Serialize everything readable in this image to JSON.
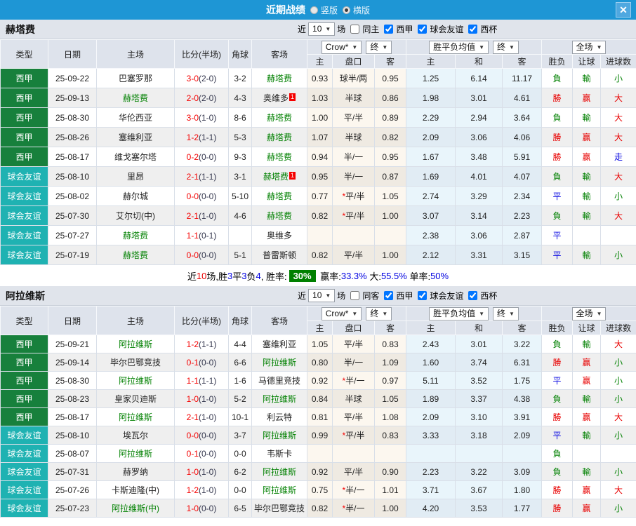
{
  "titlebar": {
    "title": "近期战绩",
    "view_options": [
      {
        "label": "竖版",
        "selected": false
      },
      {
        "label": "横版",
        "selected": true
      }
    ],
    "close_label": "✕"
  },
  "colors": {
    "accent_blue": "#1e96d5",
    "win_red": "#e80000",
    "loss_green": "#008000",
    "draw_blue": "#0000e0",
    "league_green": "#17803c",
    "friendly_teal": "#1fb2b2",
    "rate_badge_green": "#008000",
    "score_red": "#f50000"
  },
  "table_headers": {
    "cols": [
      "类型",
      "日期",
      "主场",
      "比分(半场)",
      "角球",
      "客场"
    ],
    "odds_group": {
      "bookmaker_dropdown": "Crow*",
      "final_dropdown": "终",
      "subcols": [
        "主",
        "盘口",
        "客"
      ]
    },
    "mean_group": {
      "dropdown": "胜平负均值",
      "final_dropdown": "终",
      "subcols": [
        "主",
        "和",
        "客"
      ]
    },
    "result_group": {
      "dropdown": "全场",
      "subcols": [
        "胜负",
        "让球",
        "进球数"
      ]
    }
  },
  "sections": [
    {
      "team": "赫塔费",
      "filters": {
        "near": "近",
        "count": "10",
        "unit": "场",
        "same": {
          "label": "同主",
          "checked": false
        },
        "comps": [
          {
            "label": "西甲",
            "checked": true
          },
          {
            "label": "球会友谊",
            "checked": true
          },
          {
            "label": "西杯",
            "checked": true
          }
        ]
      },
      "rows": [
        {
          "type": "西甲",
          "type_class": "league",
          "date": "25-09-22",
          "home": "巴塞罗那",
          "home_subject": false,
          "home_badge": "",
          "score_ft": "3-0",
          "score_ht": "(2-0)",
          "corners": "3-2",
          "away": "赫塔费",
          "away_subject": true,
          "away_badge": "",
          "odds_home": "0.93",
          "handicap": "球半/两",
          "handicap_star": false,
          "odds_away": "0.95",
          "mean_home": "1.25",
          "mean_draw": "6.14",
          "mean_away": "11.17",
          "result": "負",
          "result_class": "g",
          "let_ball": "輸",
          "let_class": "g",
          "goals": "小",
          "goals_class": "g"
        },
        {
          "type": "西甲",
          "type_class": "league",
          "date": "25-09-13",
          "home": "赫塔费",
          "home_subject": true,
          "home_badge": "",
          "score_ft": "2-0",
          "score_ht": "(2-0)",
          "corners": "4-3",
          "away": "奥维多",
          "away_subject": false,
          "away_badge": "1",
          "odds_home": "1.03",
          "handicap": "半球",
          "handicap_star": false,
          "odds_away": "0.86",
          "mean_home": "1.98",
          "mean_draw": "3.01",
          "mean_away": "4.61",
          "result": "勝",
          "result_class": "r",
          "let_ball": "赢",
          "let_class": "r",
          "goals": "大",
          "goals_class": "r"
        },
        {
          "type": "西甲",
          "type_class": "league",
          "date": "25-08-30",
          "home": "华伦西亚",
          "home_subject": false,
          "home_badge": "",
          "score_ft": "3-0",
          "score_ht": "(1-0)",
          "corners": "8-6",
          "away": "赫塔费",
          "away_subject": true,
          "away_badge": "",
          "odds_home": "1.00",
          "handicap": "平/半",
          "handicap_star": false,
          "odds_away": "0.89",
          "mean_home": "2.29",
          "mean_draw": "2.94",
          "mean_away": "3.64",
          "result": "負",
          "result_class": "g",
          "let_ball": "輸",
          "let_class": "g",
          "goals": "大",
          "goals_class": "r"
        },
        {
          "type": "西甲",
          "type_class": "league",
          "date": "25-08-26",
          "home": "塞维利亚",
          "home_subject": false,
          "home_badge": "",
          "score_ft": "1-2",
          "score_ht": "(1-1)",
          "corners": "5-3",
          "away": "赫塔费",
          "away_subject": true,
          "away_badge": "",
          "odds_home": "1.07",
          "handicap": "半球",
          "handicap_star": false,
          "odds_away": "0.82",
          "mean_home": "2.09",
          "mean_draw": "3.06",
          "mean_away": "4.06",
          "result": "勝",
          "result_class": "r",
          "let_ball": "赢",
          "let_class": "r",
          "goals": "大",
          "goals_class": "r"
        },
        {
          "type": "西甲",
          "type_class": "league",
          "date": "25-08-17",
          "home": "维戈塞尔塔",
          "home_subject": false,
          "home_badge": "",
          "score_ft": "0-2",
          "score_ht": "(0-0)",
          "corners": "9-3",
          "away": "赫塔费",
          "away_subject": true,
          "away_badge": "",
          "odds_home": "0.94",
          "handicap": "半/一",
          "handicap_star": false,
          "odds_away": "0.95",
          "mean_home": "1.67",
          "mean_draw": "3.48",
          "mean_away": "5.91",
          "result": "勝",
          "result_class": "r",
          "let_ball": "赢",
          "let_class": "r",
          "goals": "走",
          "goals_class": "b"
        },
        {
          "type": "球会友谊",
          "type_class": "friendly",
          "date": "25-08-10",
          "home": "里昂",
          "home_subject": false,
          "home_badge": "",
          "score_ft": "2-1",
          "score_ht": "(1-1)",
          "corners": "3-1",
          "away": "赫塔费",
          "away_subject": true,
          "away_badge": "1",
          "odds_home": "0.95",
          "handicap": "半/一",
          "handicap_star": false,
          "odds_away": "0.87",
          "mean_home": "1.69",
          "mean_draw": "4.01",
          "mean_away": "4.07",
          "result": "負",
          "result_class": "g",
          "let_ball": "輸",
          "let_class": "g",
          "goals": "大",
          "goals_class": "r"
        },
        {
          "type": "球会友谊",
          "type_class": "friendly",
          "date": "25-08-02",
          "home": "赫尔城",
          "home_subject": false,
          "home_badge": "",
          "score_ft": "0-0",
          "score_ht": "(0-0)",
          "corners": "5-10",
          "away": "赫塔费",
          "away_subject": true,
          "away_badge": "",
          "odds_home": "0.77",
          "handicap": "平/半",
          "handicap_star": true,
          "odds_away": "1.05",
          "mean_home": "2.74",
          "mean_draw": "3.29",
          "mean_away": "2.34",
          "result": "平",
          "result_class": "b",
          "let_ball": "輸",
          "let_class": "g",
          "goals": "小",
          "goals_class": "g"
        },
        {
          "type": "球会友谊",
          "type_class": "friendly",
          "date": "25-07-30",
          "home": "艾尔切(中)",
          "home_subject": false,
          "home_badge": "",
          "score_ft": "2-1",
          "score_ht": "(1-0)",
          "corners": "4-6",
          "away": "赫塔费",
          "away_subject": true,
          "away_badge": "",
          "odds_home": "0.82",
          "handicap": "平/半",
          "handicap_star": true,
          "odds_away": "1.00",
          "mean_home": "3.07",
          "mean_draw": "3.14",
          "mean_away": "2.23",
          "result": "負",
          "result_class": "g",
          "let_ball": "輸",
          "let_class": "g",
          "goals": "大",
          "goals_class": "r"
        },
        {
          "type": "球会友谊",
          "type_class": "friendly",
          "date": "25-07-27",
          "home": "赫塔费",
          "home_subject": true,
          "home_badge": "",
          "score_ft": "1-1",
          "score_ht": "(0-1)",
          "corners": "",
          "away": "奥维多",
          "away_subject": false,
          "away_badge": "",
          "odds_home": "",
          "handicap": "",
          "handicap_star": false,
          "odds_away": "",
          "mean_home": "2.38",
          "mean_draw": "3.06",
          "mean_away": "2.87",
          "result": "平",
          "result_class": "b",
          "let_ball": "",
          "let_class": "",
          "goals": "",
          "goals_class": ""
        },
        {
          "type": "球会友谊",
          "type_class": "friendly",
          "date": "25-07-19",
          "home": "赫塔费",
          "home_subject": true,
          "home_badge": "",
          "score_ft": "0-0",
          "score_ht": "(0-0)",
          "corners": "5-1",
          "away": "普雷斯顿",
          "away_subject": false,
          "away_badge": "",
          "odds_home": "0.82",
          "handicap": "平/半",
          "handicap_star": false,
          "odds_away": "1.00",
          "mean_home": "2.12",
          "mean_draw": "3.31",
          "mean_away": "3.15",
          "result": "平",
          "result_class": "b",
          "let_ball": "輸",
          "let_class": "g",
          "goals": "小",
          "goals_class": "g"
        }
      ],
      "summary_segments": [
        {
          "text": "近",
          "style": "plain"
        },
        {
          "text": "10",
          "style": "red"
        },
        {
          "text": "场,胜",
          "style": "plain"
        },
        {
          "text": "3",
          "style": "blue"
        },
        {
          "text": "平",
          "style": "plain"
        },
        {
          "text": "3",
          "style": "blue"
        },
        {
          "text": "负",
          "style": "plain"
        },
        {
          "text": "4",
          "style": "blue"
        },
        {
          "text": ", 胜率:",
          "style": "plain"
        },
        {
          "text": "30%",
          "style": "badge"
        },
        {
          "text": " 赢率:",
          "style": "plain"
        },
        {
          "text": "33.3%",
          "style": "blue"
        },
        {
          "text": " 大:",
          "style": "plain"
        },
        {
          "text": "55.5%",
          "style": "blue"
        },
        {
          "text": " 单率:",
          "style": "plain"
        },
        {
          "text": "50%",
          "style": "blue"
        }
      ]
    },
    {
      "team": "阿拉维斯",
      "filters": {
        "near": "近",
        "count": "10",
        "unit": "场",
        "same": {
          "label": "同客",
          "checked": false
        },
        "comps": [
          {
            "label": "西甲",
            "checked": true
          },
          {
            "label": "球会友谊",
            "checked": true
          },
          {
            "label": "西杯",
            "checked": true
          }
        ]
      },
      "rows": [
        {
          "type": "西甲",
          "type_class": "league",
          "date": "25-09-21",
          "home": "阿拉维斯",
          "home_subject": true,
          "home_badge": "",
          "score_ft": "1-2",
          "score_ht": "(1-1)",
          "corners": "4-4",
          "away": "塞维利亚",
          "away_subject": false,
          "away_badge": "",
          "odds_home": "1.05",
          "handicap": "平/半",
          "handicap_star": false,
          "odds_away": "0.83",
          "mean_home": "2.43",
          "mean_draw": "3.01",
          "mean_away": "3.22",
          "result": "負",
          "result_class": "g",
          "let_ball": "輸",
          "let_class": "g",
          "goals": "大",
          "goals_class": "r"
        },
        {
          "type": "西甲",
          "type_class": "league",
          "date": "25-09-14",
          "home": "毕尔巴鄂竞技",
          "home_subject": false,
          "home_badge": "",
          "score_ft": "0-1",
          "score_ht": "(0-0)",
          "corners": "6-6",
          "away": "阿拉维斯",
          "away_subject": true,
          "away_badge": "",
          "odds_home": "0.80",
          "handicap": "半/一",
          "handicap_star": false,
          "odds_away": "1.09",
          "mean_home": "1.60",
          "mean_draw": "3.74",
          "mean_away": "6.31",
          "result": "勝",
          "result_class": "r",
          "let_ball": "赢",
          "let_class": "r",
          "goals": "小",
          "goals_class": "g"
        },
        {
          "type": "西甲",
          "type_class": "league",
          "date": "25-08-30",
          "home": "阿拉维斯",
          "home_subject": true,
          "home_badge": "",
          "score_ft": "1-1",
          "score_ht": "(1-1)",
          "corners": "1-6",
          "away": "马德里竞技",
          "away_subject": false,
          "away_badge": "",
          "odds_home": "0.92",
          "handicap": "半/一",
          "handicap_star": true,
          "odds_away": "0.97",
          "mean_home": "5.11",
          "mean_draw": "3.52",
          "mean_away": "1.75",
          "result": "平",
          "result_class": "b",
          "let_ball": "赢",
          "let_class": "r",
          "goals": "小",
          "goals_class": "g"
        },
        {
          "type": "西甲",
          "type_class": "league",
          "date": "25-08-23",
          "home": "皇家贝迪斯",
          "home_subject": false,
          "home_badge": "",
          "score_ft": "1-0",
          "score_ht": "(1-0)",
          "corners": "5-2",
          "away": "阿拉维斯",
          "away_subject": true,
          "away_badge": "",
          "odds_home": "0.84",
          "handicap": "半球",
          "handicap_star": false,
          "odds_away": "1.05",
          "mean_home": "1.89",
          "mean_draw": "3.37",
          "mean_away": "4.38",
          "result": "負",
          "result_class": "g",
          "let_ball": "輸",
          "let_class": "g",
          "goals": "小",
          "goals_class": "g"
        },
        {
          "type": "西甲",
          "type_class": "league",
          "date": "25-08-17",
          "home": "阿拉维斯",
          "home_subject": true,
          "home_badge": "",
          "score_ft": "2-1",
          "score_ht": "(1-0)",
          "corners": "10-1",
          "away": "利云特",
          "away_subject": false,
          "away_badge": "",
          "odds_home": "0.81",
          "handicap": "平/半",
          "handicap_star": false,
          "odds_away": "1.08",
          "mean_home": "2.09",
          "mean_draw": "3.10",
          "mean_away": "3.91",
          "result": "勝",
          "result_class": "r",
          "let_ball": "赢",
          "let_class": "r",
          "goals": "大",
          "goals_class": "r"
        },
        {
          "type": "球会友谊",
          "type_class": "friendly",
          "date": "25-08-10",
          "home": "埃瓦尔",
          "home_subject": false,
          "home_badge": "",
          "score_ft": "0-0",
          "score_ht": "(0-0)",
          "corners": "3-7",
          "away": "阿拉维斯",
          "away_subject": true,
          "away_badge": "",
          "odds_home": "0.99",
          "handicap": "平/半",
          "handicap_star": true,
          "odds_away": "0.83",
          "mean_home": "3.33",
          "mean_draw": "3.18",
          "mean_away": "2.09",
          "result": "平",
          "result_class": "b",
          "let_ball": "輸",
          "let_class": "g",
          "goals": "小",
          "goals_class": "g"
        },
        {
          "type": "球会友谊",
          "type_class": "friendly",
          "date": "25-08-07",
          "home": "阿拉维斯",
          "home_subject": true,
          "home_badge": "",
          "score_ft": "0-1",
          "score_ht": "(0-0)",
          "corners": "0-0",
          "away": "韦斯卡",
          "away_subject": false,
          "away_badge": "",
          "odds_home": "",
          "handicap": "",
          "handicap_star": false,
          "odds_away": "",
          "mean_home": "",
          "mean_draw": "",
          "mean_away": "",
          "result": "負",
          "result_class": "g",
          "let_ball": "",
          "let_class": "",
          "goals": "",
          "goals_class": ""
        },
        {
          "type": "球会友谊",
          "type_class": "friendly",
          "date": "25-07-31",
          "home": "赫罗纳",
          "home_subject": false,
          "home_badge": "",
          "score_ft": "1-0",
          "score_ht": "(1-0)",
          "corners": "6-2",
          "away": "阿拉维斯",
          "away_subject": true,
          "away_badge": "",
          "odds_home": "0.92",
          "handicap": "平/半",
          "handicap_star": false,
          "odds_away": "0.90",
          "mean_home": "2.23",
          "mean_draw": "3.22",
          "mean_away": "3.09",
          "result": "負",
          "result_class": "g",
          "let_ball": "輸",
          "let_class": "g",
          "goals": "小",
          "goals_class": "g"
        },
        {
          "type": "球会友谊",
          "type_class": "friendly",
          "date": "25-07-26",
          "home": "卡斯迪隆(中)",
          "home_subject": false,
          "home_badge": "",
          "score_ft": "1-2",
          "score_ht": "(1-0)",
          "corners": "0-0",
          "away": "阿拉维斯",
          "away_subject": true,
          "away_badge": "",
          "odds_home": "0.75",
          "handicap": "半/一",
          "handicap_star": true,
          "odds_away": "1.01",
          "mean_home": "3.71",
          "mean_draw": "3.67",
          "mean_away": "1.80",
          "result": "勝",
          "result_class": "r",
          "let_ball": "赢",
          "let_class": "r",
          "goals": "大",
          "goals_class": "r"
        },
        {
          "type": "球会友谊",
          "type_class": "friendly",
          "date": "25-07-23",
          "home": "阿拉维斯(中)",
          "home_subject": true,
          "home_badge": "",
          "score_ft": "1-0",
          "score_ht": "(0-0)",
          "corners": "6-5",
          "away": "毕尔巴鄂竞技",
          "away_subject": false,
          "away_badge": "",
          "odds_home": "0.82",
          "handicap": "半/一",
          "handicap_star": true,
          "odds_away": "1.00",
          "mean_home": "4.20",
          "mean_draw": "3.53",
          "mean_away": "1.77",
          "result": "勝",
          "result_class": "r",
          "let_ball": "赢",
          "let_class": "r",
          "goals": "小",
          "goals_class": "g"
        }
      ],
      "summary_segments": null
    }
  ]
}
